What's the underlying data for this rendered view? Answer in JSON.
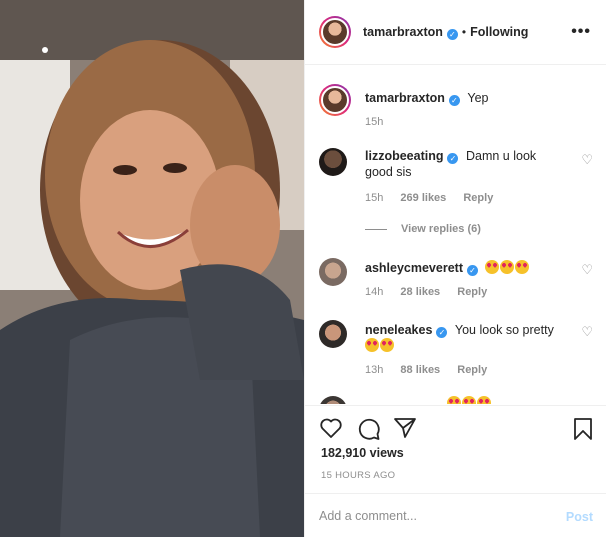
{
  "post": {
    "author": "tamarbraxton",
    "follow_state": "Following",
    "dot": "•",
    "more_icon": "more-options-icon"
  },
  "comments": [
    {
      "user": "tamarbraxton",
      "text": "Yep",
      "time": "15h",
      "likes": "",
      "reply": ""
    },
    {
      "user": "lizzobeeating",
      "text": "Damn u look good sis",
      "time": "15h",
      "likes": "269 likes",
      "reply": "Reply"
    },
    {
      "user": "ashleycmeverett",
      "text": "",
      "emoji_count": 3,
      "time": "14h",
      "likes": "28 likes",
      "reply": "Reply"
    },
    {
      "user": "neneleakes",
      "text": "You look so pretty",
      "emoji_count": 2,
      "time": "13h",
      "likes": "88 likes",
      "reply": "Reply"
    }
  ],
  "view_replies": "View replies (6)",
  "stats": {
    "views": "182,910 views",
    "time_ago": "15 HOURS AGO"
  },
  "composer": {
    "placeholder": "Add a comment...",
    "post_label": "Post"
  },
  "colors": {
    "verified": "#3897f0",
    "post_disabled": "#b3dbff",
    "muted": "#8e8e8e"
  }
}
